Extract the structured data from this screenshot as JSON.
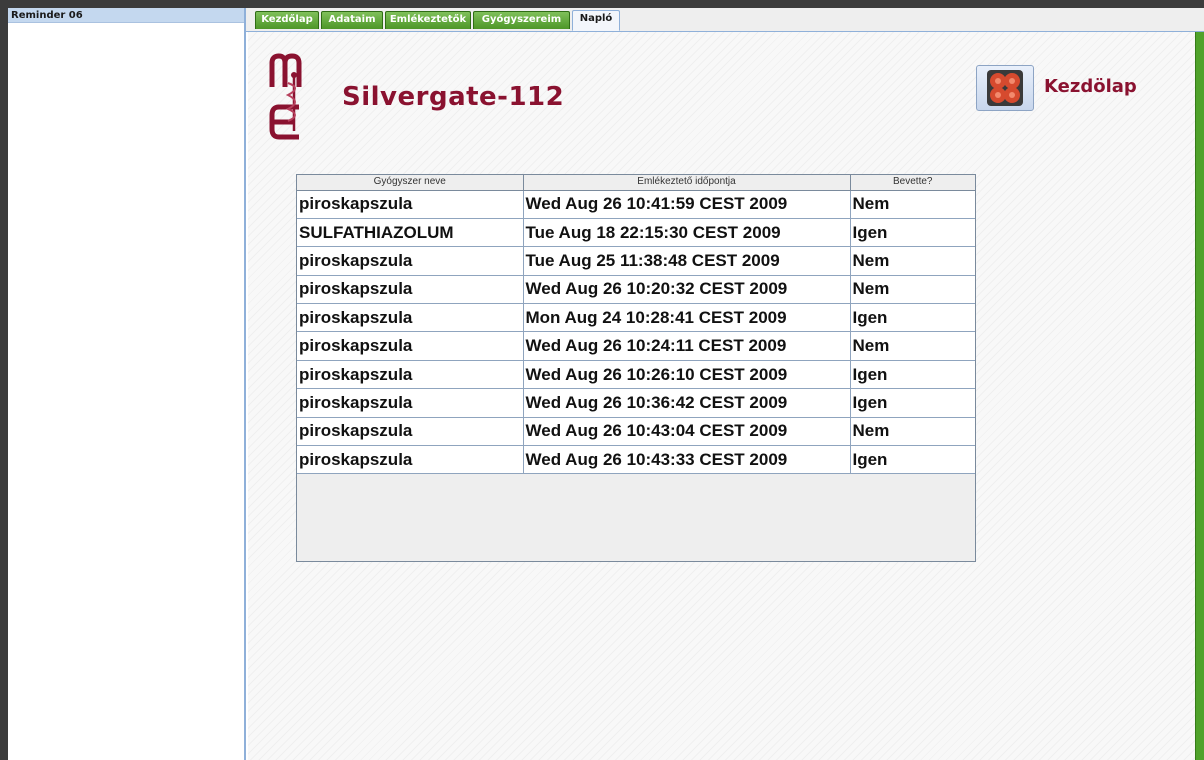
{
  "window": {
    "title": "Reminder 06"
  },
  "tabs": [
    {
      "label": "Kezdőlap",
      "active": false
    },
    {
      "label": "Adataim",
      "active": false
    },
    {
      "label": "Emlékeztetők",
      "active": false
    },
    {
      "label": "Gyógyszereim",
      "active": false
    },
    {
      "label": "Napló",
      "active": true
    }
  ],
  "header": {
    "app_name": "Silvergate-112",
    "home_label": "Kezdölap"
  },
  "icons": {
    "logo": "medical-logo-icon",
    "home": "clover-home-icon"
  },
  "colors": {
    "accent": "#8a1230",
    "tab_green": "#4d9628",
    "home_icon": "#d64a2e"
  },
  "log_table": {
    "columns": [
      "Gyógyszer neve",
      "Emlékeztető időpontja",
      "Bevette?"
    ],
    "rows": [
      [
        "piroskapszula",
        "Wed Aug 26 10:41:59 CEST 2009",
        "Nem"
      ],
      [
        "SULFATHIAZOLUM",
        "Tue Aug 18 22:15:30 CEST 2009",
        "Igen"
      ],
      [
        "piroskapszula",
        "Tue Aug 25 11:38:48 CEST 2009",
        "Nem"
      ],
      [
        "piroskapszula",
        "Wed Aug 26 10:20:32 CEST 2009",
        "Nem"
      ],
      [
        "piroskapszula",
        "Mon Aug 24 10:28:41 CEST 2009",
        "Igen"
      ],
      [
        "piroskapszula",
        "Wed Aug 26 10:24:11 CEST 2009",
        "Nem"
      ],
      [
        "piroskapszula",
        "Wed Aug 26 10:26:10 CEST 2009",
        "Igen"
      ],
      [
        "piroskapszula",
        "Wed Aug 26 10:36:42 CEST 2009",
        "Igen"
      ],
      [
        "piroskapszula",
        "Wed Aug 26 10:43:04 CEST 2009",
        "Nem"
      ],
      [
        "piroskapszula",
        "Wed Aug 26 10:43:33 CEST 2009",
        "Igen"
      ]
    ]
  }
}
